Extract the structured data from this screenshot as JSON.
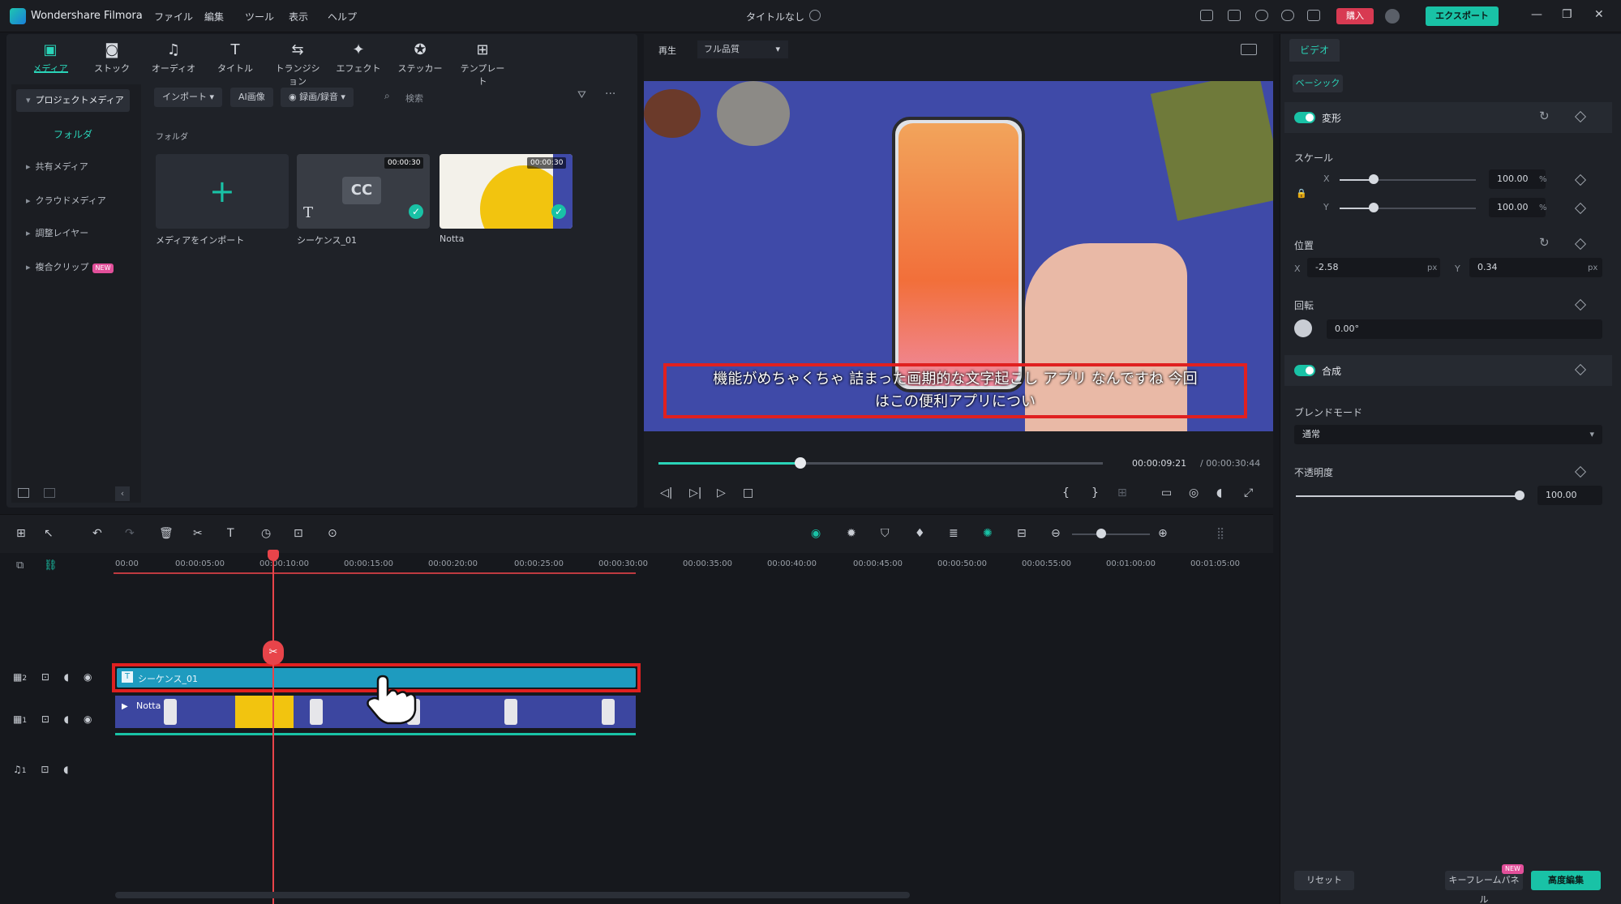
{
  "titlebar": {
    "app_name": "Wondershare Filmora",
    "menus": [
      "ファイル",
      "編集",
      "ツール",
      "表示",
      "ヘルプ"
    ],
    "document_title": "タイトルなし",
    "buy_label": "購入",
    "export_label": "エクスポート"
  },
  "toolbar_tabs": [
    {
      "label": "メディア",
      "icon": "media-icon"
    },
    {
      "label": "ストック",
      "icon": "stock-icon"
    },
    {
      "label": "オーディオ",
      "icon": "music-note-icon"
    },
    {
      "label": "タイトル",
      "icon": "title-T-icon"
    },
    {
      "label": "トランジション",
      "icon": "transition-icon"
    },
    {
      "label": "エフェクト",
      "icon": "effect-icon"
    },
    {
      "label": "ステッカー",
      "icon": "sticker-icon"
    },
    {
      "label": "テンプレート",
      "icon": "template-icon"
    }
  ],
  "left_nav": {
    "project_media": "プロジェクトメディア",
    "folder": "フォルダ",
    "items": [
      "共有メディア",
      "クラウドメディア",
      "調整レイヤー",
      "複合クリップ"
    ],
    "new_badge": "NEW"
  },
  "media_toolbar": {
    "import": "インポート",
    "ai_image": "AI画像",
    "record": "録画/録音",
    "search_placeholder": "検索"
  },
  "media_grid": {
    "heading": "フォルダ",
    "items": [
      {
        "label": "メディアをインポート",
        "duration": ""
      },
      {
        "label": "シーケンス_01",
        "duration": "00:00:30"
      },
      {
        "label": "Notta",
        "duration": "00:00:30"
      }
    ]
  },
  "preview": {
    "tab": "再生",
    "quality": "フル品質",
    "caption_line1": "機能がめちゃくちゃ 詰まった画期的な文字起こし アプリ なんですね 今回",
    "caption_line2": "はこの便利アプリについ",
    "time_current": "00:00:09:21",
    "time_total": "/ 00:00:30:44",
    "progress": 0.32
  },
  "properties": {
    "tab_video": "ビデオ",
    "tab_basic": "ベーシック",
    "transform": "変形",
    "scale": "スケール",
    "scale_x": "100.00",
    "scale_y": "100.00",
    "percent": "%",
    "position": "位置",
    "pos_x": "-2.58",
    "pos_y": "0.34",
    "px": "px",
    "rotation": "回転",
    "rotation_value": "0.00°",
    "composite": "合成",
    "blend_mode": "ブレンドモード",
    "blend_value": "通常",
    "opacity": "不透明度",
    "opacity_value": "100.00",
    "reset": "リセット",
    "keyframe_panel": "キーフレームパネル",
    "advanced_edit": "高度編集",
    "new_badge": "NEW"
  },
  "timeline": {
    "ticks": [
      "00:00",
      "00:00:05:00",
      "00:00:10:00",
      "00:00:15:00",
      "00:00:20:00",
      "00:00:25:00",
      "00:00:30:00",
      "00:00:35:00",
      "00:00:40:00",
      "00:00:45:00",
      "00:00:50:00",
      "00:00:55:00",
      "00:01:00:00",
      "00:01:05:00"
    ],
    "track2_label": "2",
    "track1_label": "1",
    "audio_label": "1",
    "caption_clip": "シーケンス_01",
    "video_clip": "Notta"
  },
  "colors": {
    "accent": "#19c2a6",
    "highlight_red": "#e02020",
    "playhead": "#e8444a"
  }
}
